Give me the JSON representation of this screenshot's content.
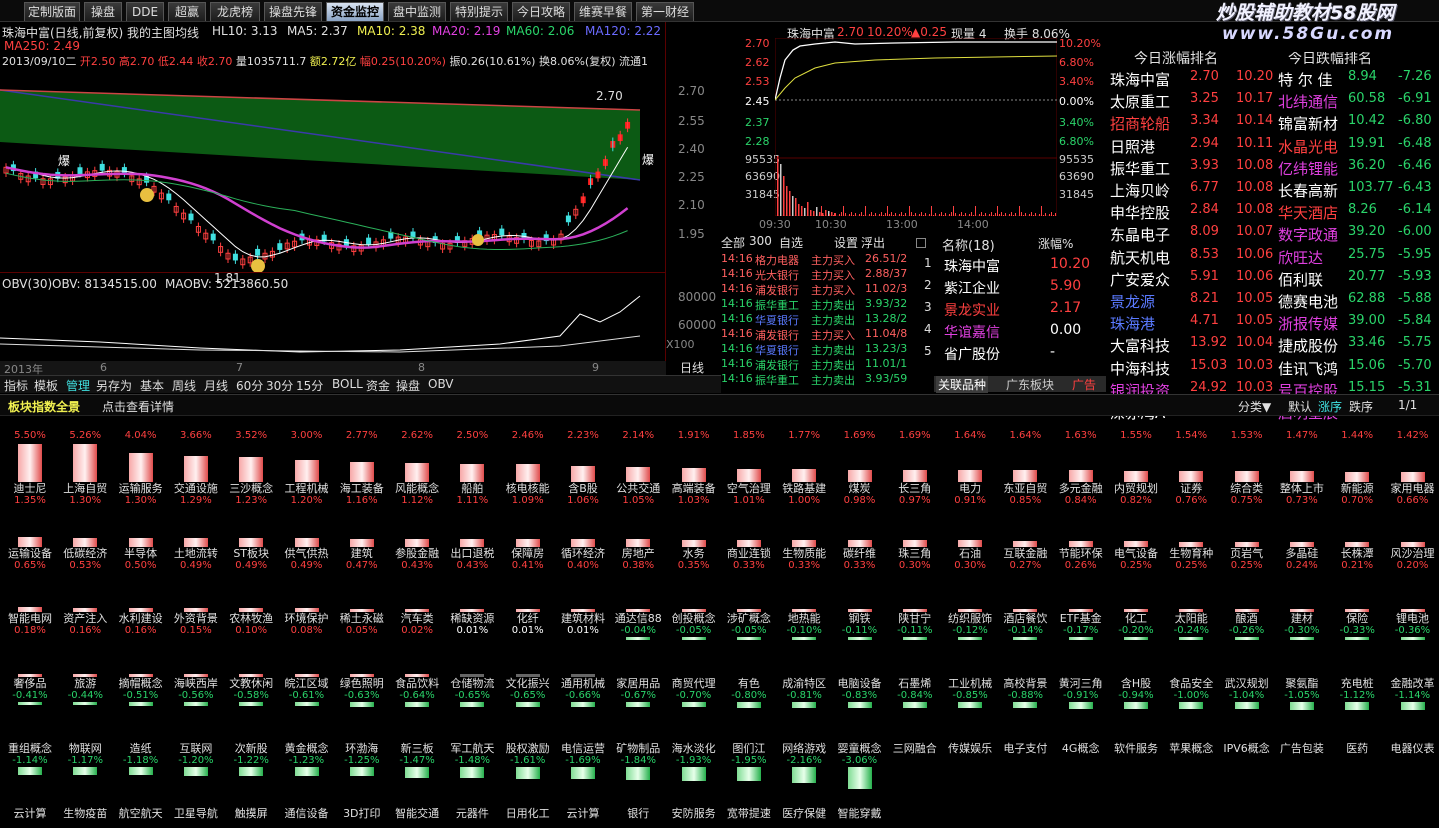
{
  "tabs": [
    "定制版面",
    "操盘",
    "DDE",
    "超赢",
    "龙虎榜",
    "操盘先锋",
    "资金监控",
    "盘中监测",
    "特别提示",
    "今日攻略",
    "维赛早餐",
    "第一财经"
  ],
  "active_tab": "资金监控",
  "watermark": {
    "line1": "炒股辅助教材58股网",
    "line2": "www.58Gu.com"
  },
  "kline": {
    "title": "珠海中富(日线,前复权) 我的主图均线",
    "hl10": "HL10: 3.13",
    "ma5": "MA5: 2.37",
    "ma10": "MA10: 2.38",
    "ma20": "MA20: 2.19",
    "ma60": "MA60: 2.06",
    "ma120": "MA120: 2.22",
    "ma250": "MA250: 2.49",
    "info_date": "2013/09/10二",
    "info_open": "开2.50",
    "info_high": "高2.70",
    "info_low": "低2.44",
    "info_close": "收2.70",
    "info_vol": "量1035711.7",
    "info_amt": "额2.72亿",
    "info_chg": "幅0.25(10.20%)",
    "info_amp": "振0.26(10.61%)",
    "info_turn": "换8.06%(复权)",
    "info_flow": "流通1",
    "price_labels": [
      "2.70",
      "2.55",
      "2.40",
      "2.25",
      "2.10",
      "1.95"
    ],
    "high_mark": "2.70",
    "low_mark": "1.81",
    "burst": "爆",
    "obv_title": "OBV(30)",
    "obv": "OBV: 8134515.00",
    "maobv": "MAOBV: 5213860.50",
    "obv_labels": [
      "80000",
      "60000",
      "X100"
    ],
    "x_labels": [
      "2013年",
      "6",
      "7",
      "8",
      "9"
    ]
  },
  "chart_data": {
    "type": "line",
    "title": "珠海中富(日线,前复权)",
    "x": [
      "2013-05",
      "2013-06",
      "2013-07",
      "2013-08",
      "2013-09"
    ],
    "series": [
      {
        "name": "MA5",
        "values": [
          2.38,
          2.15,
          2.02,
          2.05,
          2.37
        ]
      },
      {
        "name": "MA20",
        "values": [
          2.36,
          2.22,
          2.08,
          2.08,
          2.19
        ]
      }
    ],
    "ylim": [
      1.81,
      2.7
    ]
  },
  "bottom_tabs": [
    "指标",
    "模板",
    "管理",
    "另存为",
    "基本",
    "周线",
    "月线",
    "60分",
    "30分",
    "15分",
    "BOLL",
    "资金",
    "操盘",
    "OBV",
    "日线",
    "+",
    "-",
    "Z"
  ],
  "mini": {
    "name": "珠海中富",
    "price": "2.70",
    "pct": "10.20%",
    "chg": "▲0.25",
    "now_vol": "现量 4",
    "turnover": "换手 8.06%",
    "left_labels": [
      "2.70",
      "2.62",
      "2.53",
      "2.45",
      "2.37",
      "2.28",
      "95535",
      "63690",
      "31845"
    ],
    "right_labels": [
      "10.20%",
      "6.80%",
      "3.40%",
      "0.00%",
      "3.40%",
      "6.80%",
      "95535",
      "63690",
      "31845"
    ],
    "times": [
      "09:30",
      "10:30",
      "13:00",
      "14:00"
    ]
  },
  "trades": {
    "head": [
      "全部",
      "300",
      "自选",
      "设置",
      "浮出"
    ],
    "rows": [
      {
        "t": "14:16",
        "n": "格力电器",
        "a": "主力买入",
        "v": "26.51/2"
      },
      {
        "t": "14:16",
        "n": "光大银行",
        "a": "主力买入",
        "v": "2.88/37"
      },
      {
        "t": "14:16",
        "n": "浦发银行",
        "a": "主力买入",
        "v": "11.02/3"
      },
      {
        "t": "14:16",
        "n": "振华重工",
        "a": "主力卖出",
        "v": "3.93/32"
      },
      {
        "t": "14:16",
        "n": "华夏银行",
        "a": "主力卖出",
        "v": "13.28/2"
      },
      {
        "t": "14:16",
        "n": "浦发银行",
        "a": "主力买入",
        "v": "11.04/8"
      },
      {
        "t": "14:16",
        "n": "华夏银行",
        "a": "主力卖出",
        "v": "13.23/3"
      },
      {
        "t": "14:16",
        "n": "浦发银行",
        "a": "主力卖出",
        "v": "11.01/1"
      },
      {
        "t": "14:16",
        "n": "振华重工",
        "a": "主力卖出",
        "v": "3.93/59"
      }
    ]
  },
  "rank": {
    "head_name": "名称(18)",
    "head_pct": "涨幅%",
    "rows": [
      {
        "i": "1",
        "n": "珠海中富",
        "p": "10.20"
      },
      {
        "i": "2",
        "n": "紫江企业",
        "p": "5.90"
      },
      {
        "i": "3",
        "n": "景龙实业",
        "p": "2.17"
      },
      {
        "i": "4",
        "n": "华谊嘉信",
        "p": "0.00"
      },
      {
        "i": "5",
        "n": "省广股份",
        "p": "-"
      }
    ],
    "tabs": [
      "关联品种",
      "广东板块",
      "广告"
    ]
  },
  "limit": {
    "title": "今日涨幅排名",
    "title2": "今日跌幅排名",
    "rows": [
      {
        "a": "珠海中富",
        "ap": "2.70",
        "ar": "10.20",
        "b": "特 尔 佳",
        "bp": "8.94",
        "br": "-7.26"
      },
      {
        "a": "太原重工",
        "ap": "3.25",
        "ar": "10.17",
        "b": "北纬通信",
        "bp": "60.58",
        "br": "-6.91"
      },
      {
        "a": "招商轮船",
        "ap": "3.34",
        "ar": "10.14",
        "b": "锦富新材",
        "bp": "10.42",
        "br": "-6.80"
      },
      {
        "a": "日照港",
        "ap": "2.94",
        "ar": "10.11",
        "b": "水晶光电",
        "bp": "19.91",
        "br": "-6.48"
      },
      {
        "a": "振华重工",
        "ap": "3.93",
        "ar": "10.08",
        "b": "亿纬锂能",
        "bp": "36.20",
        "br": "-6.46"
      },
      {
        "a": "上海贝岭",
        "ap": "6.77",
        "ar": "10.08",
        "b": "长春高新",
        "bp": "103.77",
        "br": "-6.43"
      },
      {
        "a": "申华控股",
        "ap": "2.84",
        "ar": "10.08",
        "b": "华天酒店",
        "bp": "8.26",
        "br": "-6.14"
      },
      {
        "a": "东晶电子",
        "ap": "8.09",
        "ar": "10.07",
        "b": "数字政通",
        "bp": "39.20",
        "br": "-6.00"
      },
      {
        "a": "航天机电",
        "ap": "8.53",
        "ar": "10.06",
        "b": "欣旺达",
        "bp": "25.75",
        "br": "-5.95"
      },
      {
        "a": "广安爱众",
        "ap": "5.91",
        "ar": "10.06",
        "b": "佰利联",
        "bp": "20.77",
        "br": "-5.93"
      },
      {
        "a": "景龙源",
        "ap": "8.21",
        "ar": "10.05",
        "b": "德赛电池",
        "bp": "62.88",
        "br": "-5.88"
      },
      {
        "a": "珠海港",
        "ap": "4.71",
        "ar": "10.05",
        "b": "浙报传媒",
        "bp": "39.00",
        "br": "-5.84"
      },
      {
        "a": "大富科技",
        "ap": "13.92",
        "ar": "10.04",
        "b": "捷成股份",
        "bp": "33.46",
        "br": "-5.75"
      },
      {
        "a": "中海科技",
        "ap": "15.03",
        "ar": "10.03",
        "b": "佳讯飞鸿",
        "bp": "15.06",
        "br": "-5.70"
      },
      {
        "a": "银润投资",
        "ap": "24.92",
        "ar": "10.03",
        "b": "号百控股",
        "bp": "15.15",
        "br": "-5.31"
      },
      {
        "a": "深赤湾A",
        "ap": "15.15",
        "ar": "10.02",
        "b": "启明星辰",
        "bp": "24.15",
        "br": "-5.29"
      }
    ]
  },
  "sector_header": {
    "title": "板块指数全景",
    "hint": "点击查看详情",
    "sort": "分类▼",
    "default": "默认",
    "up": "涨序",
    "down": "跌序",
    "page": "1/1"
  },
  "sectors": [
    [
      "迪士尼",
      "5.50%",
      5.5
    ],
    [
      "上海自贸",
      "5.26%",
      5.26
    ],
    [
      "运输服务",
      "4.04%",
      4.04
    ],
    [
      "交通设施",
      "3.66%",
      3.66
    ],
    [
      "三沙概念",
      "3.52%",
      3.52
    ],
    [
      "工程机械",
      "3.00%",
      3.0
    ],
    [
      "海工装备",
      "2.77%",
      2.77
    ],
    [
      "风能概念",
      "2.62%",
      2.62
    ],
    [
      "船舶",
      "2.50%",
      2.5
    ],
    [
      "核电核能",
      "2.46%",
      2.46
    ],
    [
      "含B股",
      "2.23%",
      2.23
    ],
    [
      "公共交通",
      "2.14%",
      2.14
    ],
    [
      "高端装备",
      "1.91%",
      1.91
    ],
    [
      "空气治理",
      "1.85%",
      1.85
    ],
    [
      "铁路基建",
      "1.77%",
      1.77
    ],
    [
      "煤炭",
      "1.69%",
      1.69
    ],
    [
      "长三角",
      "1.69%",
      1.69
    ],
    [
      "电力",
      "1.64%",
      1.64
    ],
    [
      "东亚自贸",
      "1.64%",
      1.64
    ],
    [
      "多元金融",
      "1.63%",
      1.63
    ],
    [
      "内贸规划",
      "1.55%",
      1.55
    ],
    [
      "证券",
      "1.54%",
      1.54
    ],
    [
      "综合类",
      "1.53%",
      1.53
    ],
    [
      "整体上市",
      "1.47%",
      1.47
    ],
    [
      "新能源",
      "1.44%",
      1.44
    ],
    [
      "家用电器",
      "1.42%",
      1.42
    ],
    [
      "运输设备",
      "1.35%",
      1.35
    ],
    [
      "低碳经济",
      "1.30%",
      1.3
    ],
    [
      "半导体",
      "1.30%",
      1.3
    ],
    [
      "土地流转",
      "1.29%",
      1.29
    ],
    [
      "ST板块",
      "1.23%",
      1.23
    ],
    [
      "供气供热",
      "1.20%",
      1.2
    ],
    [
      "建筑",
      "1.16%",
      1.16
    ],
    [
      "参股金融",
      "1.12%",
      1.12
    ],
    [
      "出口退税",
      "1.11%",
      1.11
    ],
    [
      "保障房",
      "1.09%",
      1.09
    ],
    [
      "循环经济",
      "1.06%",
      1.06
    ],
    [
      "房地产",
      "1.05%",
      1.05
    ],
    [
      "水务",
      "1.03%",
      1.03
    ],
    [
      "商业连锁",
      "1.01%",
      1.01
    ],
    [
      "生物质能",
      "1.00%",
      1.0
    ],
    [
      "碳纤维",
      "0.98%",
      0.98
    ],
    [
      "珠三角",
      "0.97%",
      0.97
    ],
    [
      "石油",
      "0.91%",
      0.91
    ],
    [
      "互联金融",
      "0.85%",
      0.85
    ],
    [
      "节能环保",
      "0.84%",
      0.84
    ],
    [
      "电气设备",
      "0.82%",
      0.82
    ],
    [
      "生物育种",
      "0.76%",
      0.76
    ],
    [
      "页岩气",
      "0.75%",
      0.75
    ],
    [
      "多晶硅",
      "0.73%",
      0.73
    ],
    [
      "长株潭",
      "0.70%",
      0.7
    ],
    [
      "风沙治理",
      "0.66%",
      0.66
    ],
    [
      "智能电网",
      "0.65%",
      0.65
    ],
    [
      "资产注入",
      "0.53%",
      0.53
    ],
    [
      "水利建设",
      "0.50%",
      0.5
    ],
    [
      "外资背景",
      "0.49%",
      0.49
    ],
    [
      "农林牧渔",
      "0.49%",
      0.49
    ],
    [
      "环境保护",
      "0.49%",
      0.49
    ],
    [
      "稀土永磁",
      "0.47%",
      0.47
    ],
    [
      "汽车类",
      "0.43%",
      0.43
    ],
    [
      "稀缺资源",
      "0.43%",
      0.43
    ],
    [
      "化纤",
      "0.41%",
      0.41
    ],
    [
      "建筑材料",
      "0.40%",
      0.4
    ],
    [
      "通达信88",
      "0.38%",
      0.38
    ],
    [
      "创投概念",
      "0.35%",
      0.35
    ],
    [
      "涉矿概念",
      "0.33%",
      0.33
    ],
    [
      "地热能",
      "0.33%",
      0.33
    ],
    [
      "钢铁",
      "0.33%",
      0.33
    ],
    [
      "陕甘宁",
      "0.30%",
      0.3
    ],
    [
      "纺织服饰",
      "0.30%",
      0.3
    ],
    [
      "酒店餐饮",
      "0.27%",
      0.27
    ],
    [
      "ETF基金",
      "0.26%",
      0.26
    ],
    [
      "化工",
      "0.25%",
      0.25
    ],
    [
      "太阳能",
      "0.25%",
      0.25
    ],
    [
      "酿酒",
      "0.25%",
      0.25
    ],
    [
      "建材",
      "0.24%",
      0.24
    ],
    [
      "保险",
      "0.21%",
      0.21
    ],
    [
      "锂电池",
      "0.20%",
      0.2
    ],
    [
      "奢侈品",
      "0.18%",
      0.18
    ],
    [
      "旅游",
      "0.16%",
      0.16
    ],
    [
      "摘帽概念",
      "0.16%",
      0.16
    ],
    [
      "海峡西岸",
      "0.15%",
      0.15
    ],
    [
      "文教休闲",
      "0.10%",
      0.1
    ],
    [
      "皖江区域",
      "0.08%",
      0.08
    ],
    [
      "绿色照明",
      "0.05%",
      0.05
    ],
    [
      "食品饮料",
      "0.02%",
      0.02
    ],
    [
      "仓储物流",
      "0.01%",
      0.01
    ],
    [
      "文化振兴",
      "0.01%",
      0.01
    ],
    [
      "通用机械",
      "0.01%",
      0.01
    ],
    [
      "家居用品",
      "-0.04%",
      -0.04
    ],
    [
      "商贸代理",
      "-0.05%",
      -0.05
    ],
    [
      "有色",
      "-0.05%",
      -0.05
    ],
    [
      "成渝特区",
      "-0.10%",
      -0.1
    ],
    [
      "电脑设备",
      "-0.11%",
      -0.11
    ],
    [
      "石墨烯",
      "-0.11%",
      -0.11
    ],
    [
      "工业机械",
      "-0.12%",
      -0.12
    ],
    [
      "高校背景",
      "-0.14%",
      -0.14
    ],
    [
      "黄河三角",
      "-0.17%",
      -0.17
    ],
    [
      "含H股",
      "-0.20%",
      -0.2
    ],
    [
      "食品安全",
      "-0.24%",
      -0.24
    ],
    [
      "武汉规划",
      "-0.26%",
      -0.26
    ],
    [
      "聚氨酯",
      "-0.30%",
      -0.3
    ],
    [
      "充电桩",
      "-0.33%",
      -0.33
    ],
    [
      "金融改革",
      "-0.36%",
      -0.36
    ],
    [
      "重组概念",
      "-0.41%",
      -0.41
    ],
    [
      "物联网",
      "-0.44%",
      -0.44
    ],
    [
      "造纸",
      "-0.51%",
      -0.51
    ],
    [
      "互联网",
      "-0.56%",
      -0.56
    ],
    [
      "次新股",
      "-0.58%",
      -0.58
    ],
    [
      "黄金概念",
      "-0.61%",
      -0.61
    ],
    [
      "环渤海",
      "-0.63%",
      -0.63
    ],
    [
      "新三板",
      "-0.64%",
      -0.64
    ],
    [
      "军工航天",
      "-0.65%",
      -0.65
    ],
    [
      "股权激励",
      "-0.65%",
      -0.65
    ],
    [
      "电信运营",
      "-0.66%",
      -0.66
    ],
    [
      "矿物制品",
      "-0.67%",
      -0.67
    ],
    [
      "海水淡化",
      "-0.70%",
      -0.7
    ],
    [
      "图们江",
      "-0.80%",
      -0.8
    ],
    [
      "网络游戏",
      "-0.81%",
      -0.81
    ],
    [
      "婴童概念",
      "-0.83%",
      -0.83
    ],
    [
      "三网融合",
      "-0.84%",
      -0.84
    ],
    [
      "传媒娱乐",
      "-0.85%",
      -0.85
    ],
    [
      "电子支付",
      "-0.88%",
      -0.88
    ],
    [
      "4G概念",
      "-0.91%",
      -0.91
    ],
    [
      "软件服务",
      "-0.94%",
      -0.94
    ],
    [
      "苹果概念",
      "-1.00%",
      -1.0
    ],
    [
      "IPV6概念",
      "-1.04%",
      -1.04
    ],
    [
      "广告包装",
      "-1.05%",
      -1.05
    ],
    [
      "医药",
      "-1.12%",
      -1.12
    ],
    [
      "电器仪表",
      "-1.14%",
      -1.14
    ],
    [
      "云计算",
      "-1.14%",
      -1.14
    ],
    [
      "生物疫苗",
      "-1.17%",
      -1.17
    ],
    [
      "航空航天",
      "-1.18%",
      -1.18
    ],
    [
      "卫星导航",
      "-1.20%",
      -1.2
    ],
    [
      "触摸屏",
      "-1.22%",
      -1.22
    ],
    [
      "通信设备",
      "-1.23%",
      -1.23
    ],
    [
      "3D打印",
      "-1.25%",
      -1.25
    ],
    [
      "智能交通",
      "-1.47%",
      -1.47
    ],
    [
      "元器件",
      "-1.48%",
      -1.48
    ],
    [
      "日用化工",
      "-1.61%",
      -1.61
    ],
    [
      "云计算",
      "-1.69%",
      -1.69
    ],
    [
      "银行",
      "-1.84%",
      -1.84
    ],
    [
      "安防服务",
      "-1.93%",
      -1.93
    ],
    [
      "宽带提速",
      "-1.95%",
      -1.95
    ],
    [
      "医疗保健",
      "-2.16%",
      -2.16
    ],
    [
      "智能穿戴",
      "-3.06%",
      -3.06
    ]
  ],
  "colors": {
    "up": "#ff4040",
    "down": "#2ad46a",
    "bg": "#000000",
    "accent_tab": "#9fb6d6"
  }
}
